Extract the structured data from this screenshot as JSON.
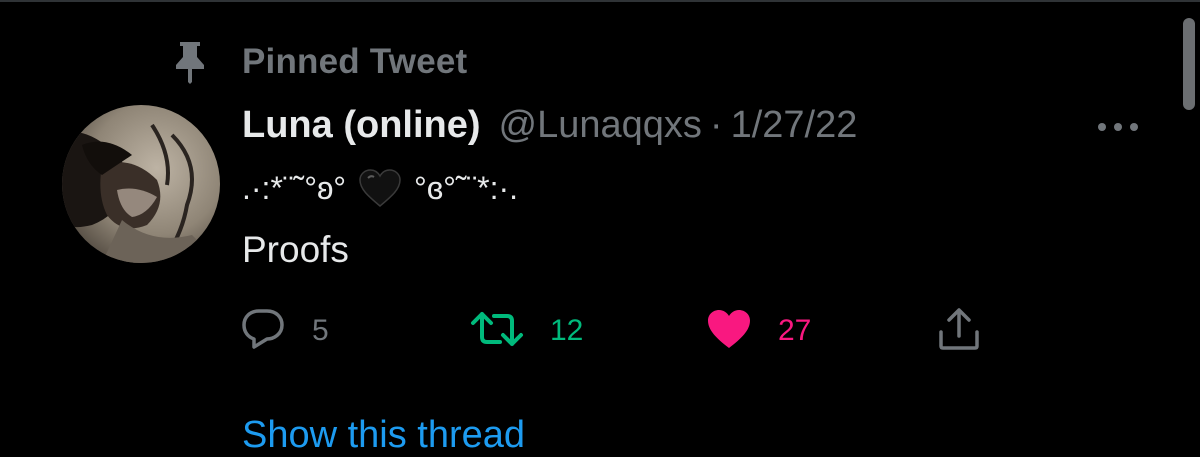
{
  "pinned": {
    "label": "Pinned Tweet",
    "icon": "pin-icon"
  },
  "tweet": {
    "display_name": "Luna (online)",
    "handle": "@Lunaqqxs",
    "separator": "·",
    "date": "1/27/22",
    "decor_left": ".·:*¨¨༺༻¨",
    "decor_left_text": ".·:*¨˜°ʚ°",
    "decor_right_text": "°ɞ°˜¨*:·.",
    "text": "Proofs",
    "more_icon": "more-dots-icon",
    "avatar_icon": "avatar"
  },
  "actions": {
    "reply_count": "5",
    "retweet_count": "12",
    "like_count": "27",
    "liked": true,
    "share_icon": "share-icon"
  },
  "show_thread_label": "Show this thread",
  "colors": {
    "background": "#000000",
    "primary_text": "#e7e9ea",
    "secondary_text": "#71767b",
    "retweet_green": "#00ba7c",
    "like_pink": "#f91880",
    "link_blue": "#1d9bf0"
  }
}
